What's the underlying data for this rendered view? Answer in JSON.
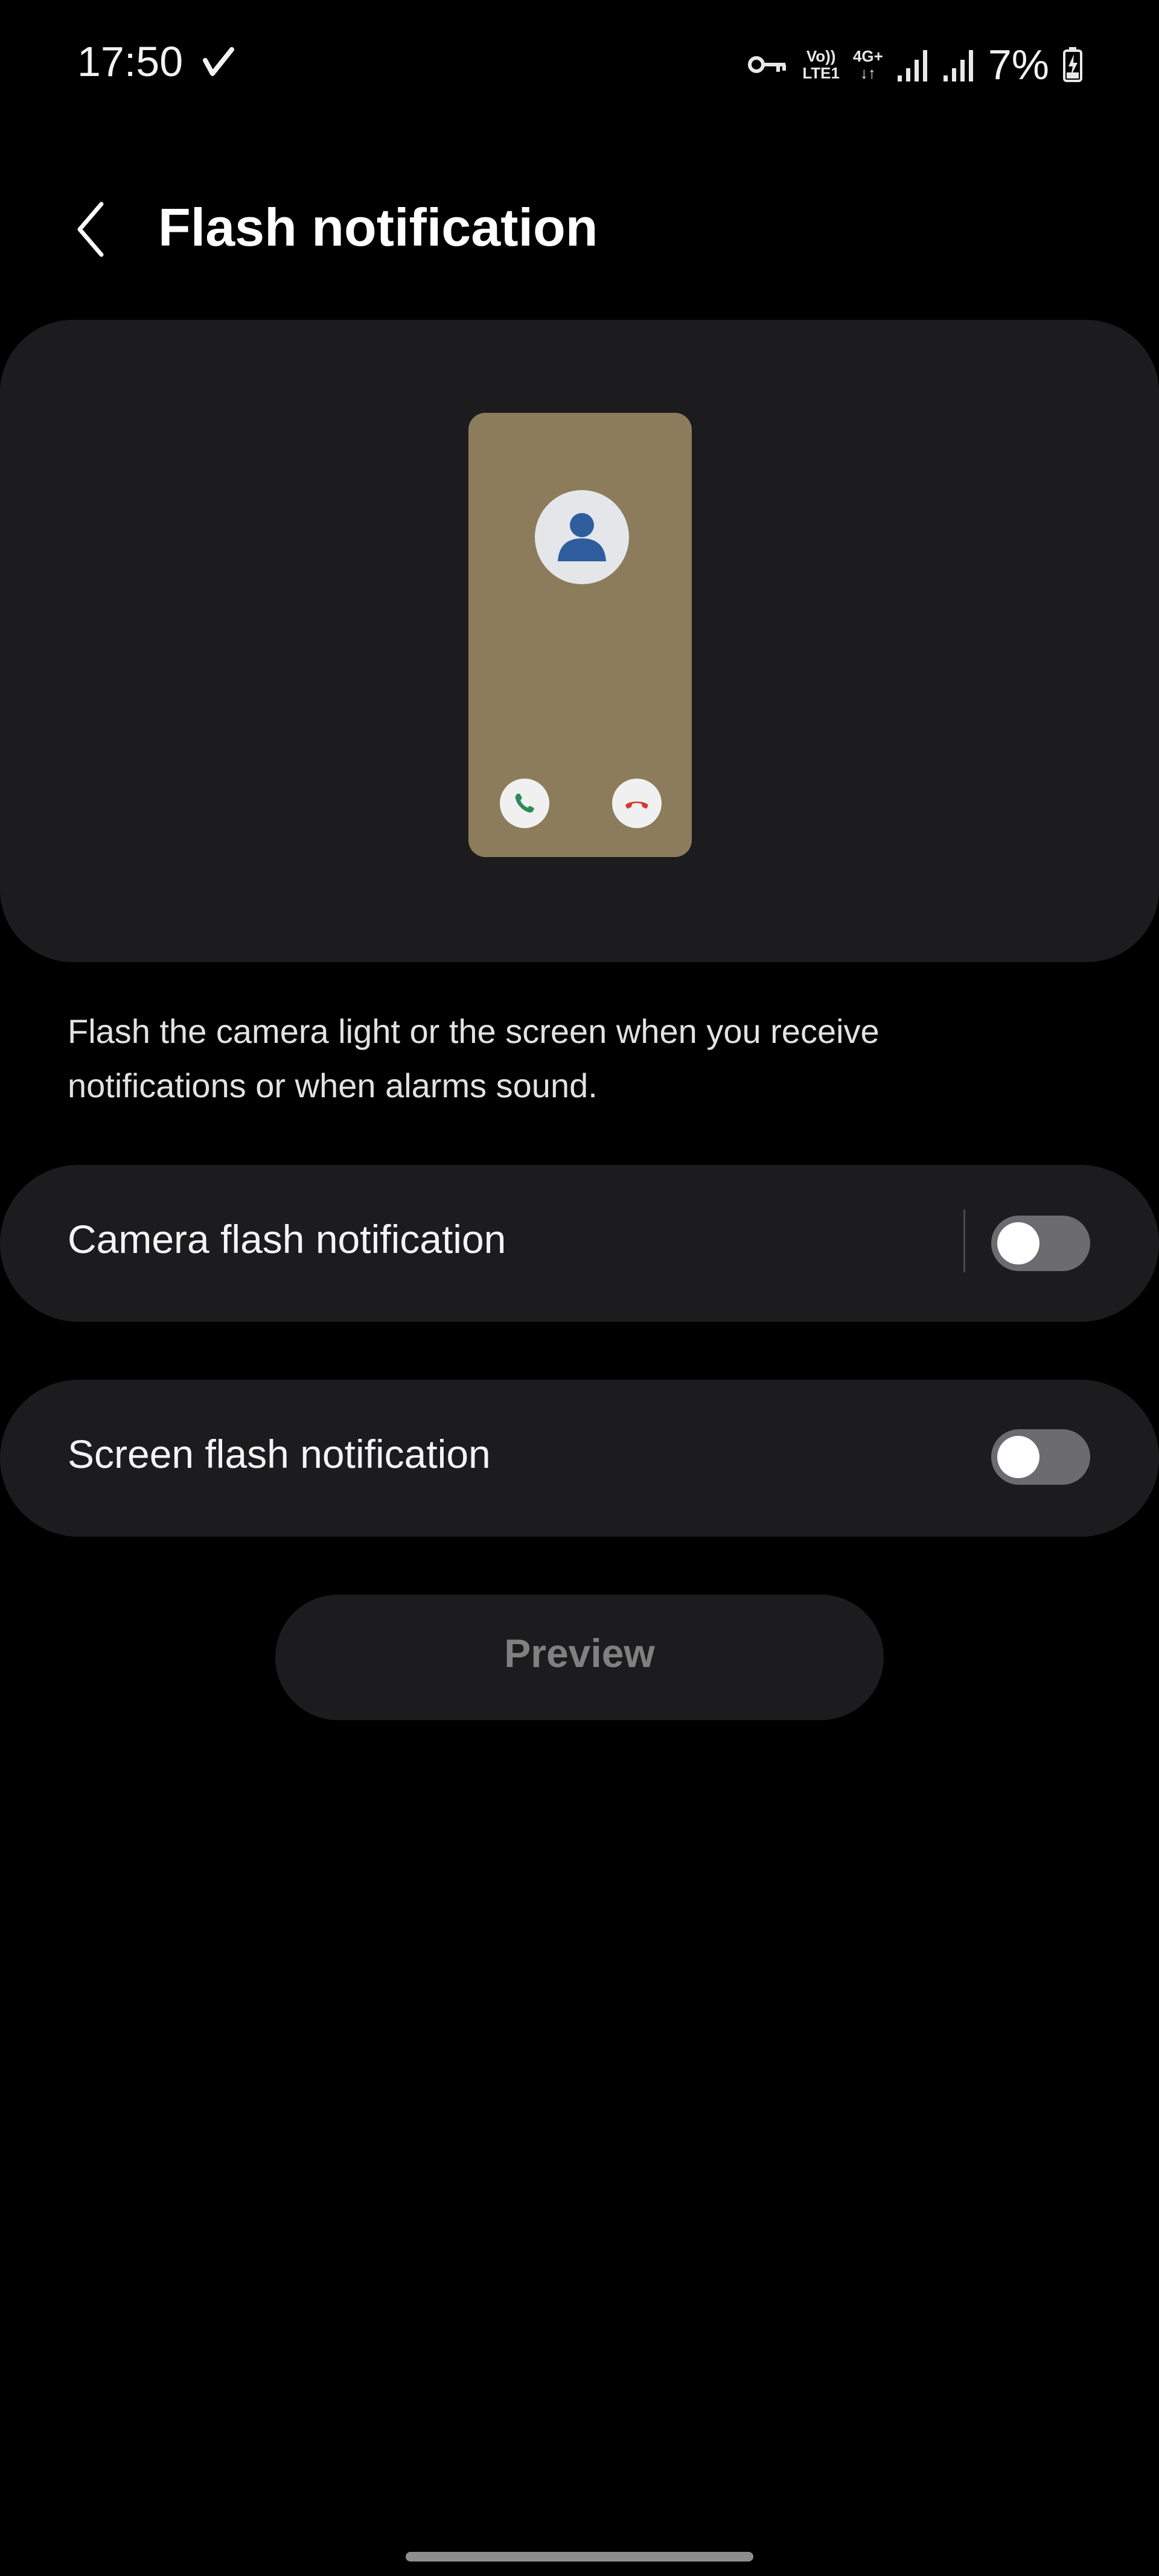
{
  "status_bar": {
    "time": "17:50",
    "volte_label_top": "Vo))",
    "volte_label_bottom": "LTE1",
    "network_label_top": "4G+",
    "network_label_bottom": "↓↑",
    "battery_percent": "7%",
    "icons": [
      "checkmark-icon",
      "vpn-key-icon",
      "signal-icon",
      "signal-icon",
      "battery-charging-icon"
    ]
  },
  "header": {
    "title": "Flash notification",
    "back_icon": "chevron-left-icon"
  },
  "illustration": {
    "icons": [
      "person-icon",
      "phone-accept-icon",
      "phone-decline-icon"
    ],
    "colors": {
      "phone_screen": "#8c7c5c",
      "avatar_bg": "#e4e6ea",
      "person": "#2f5d9e",
      "accept": "#2e8b57",
      "decline": "#d23a2f"
    }
  },
  "description": "Flash the camera light or the screen when you receive notifications or when alarms sound.",
  "settings": [
    {
      "label": "Camera flash notification",
      "enabled": false
    },
    {
      "label": "Screen flash notification",
      "enabled": false
    }
  ],
  "preview_button": {
    "label": "Preview"
  },
  "colors": {
    "background": "#000000",
    "card": "#1c1c1e",
    "toggle_off": "#6b6b70"
  }
}
